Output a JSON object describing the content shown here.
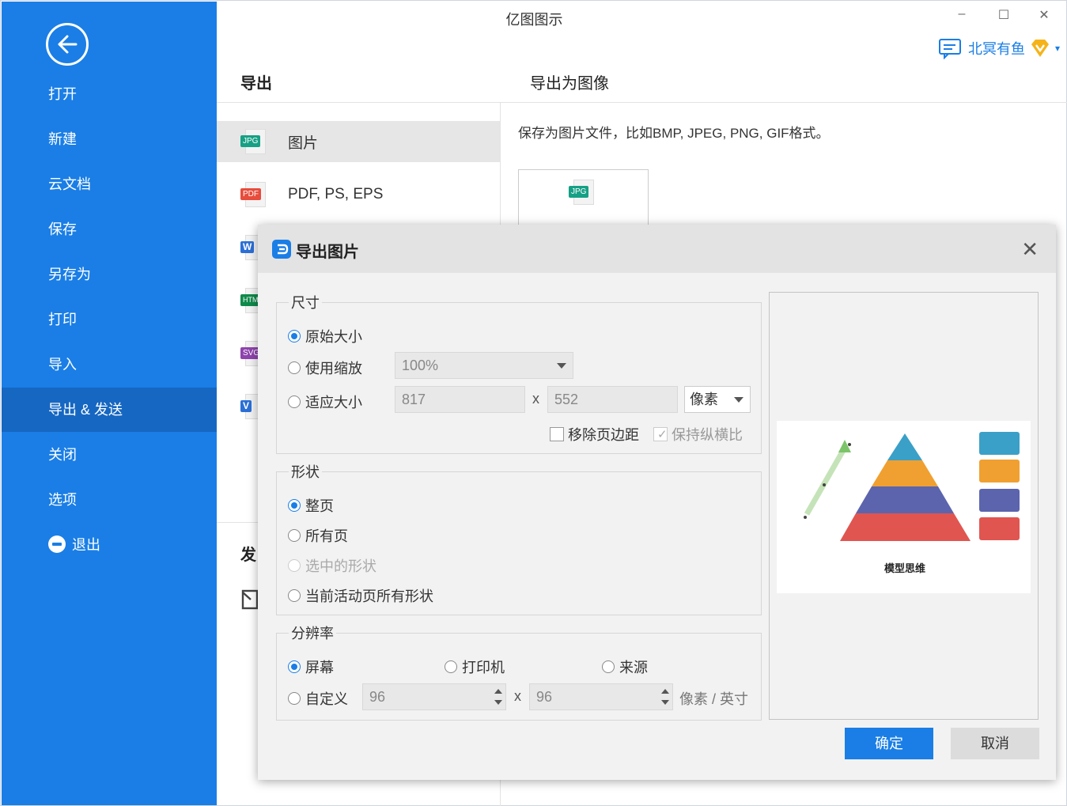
{
  "window": {
    "title": "亿图图示",
    "minimize_label": "–",
    "maximize_label": "☐",
    "close_label": "✕"
  },
  "user": {
    "name": "北冥有鱼",
    "badge": "V",
    "menu_caret": "▾"
  },
  "sidebar": {
    "items": [
      {
        "label": "打开"
      },
      {
        "label": "新建"
      },
      {
        "label": "云文档"
      },
      {
        "label": "保存"
      },
      {
        "label": "另存为"
      },
      {
        "label": "打印"
      },
      {
        "label": "导入"
      },
      {
        "label": "导出 & 发送"
      },
      {
        "label": "关闭"
      },
      {
        "label": "选项"
      },
      {
        "label": "退出"
      }
    ],
    "active_index": 7
  },
  "export_panel": {
    "heading": "导出",
    "formats": [
      {
        "label": "图片",
        "tag": "JPG",
        "tag_color": "#16a085"
      },
      {
        "label": "PDF, PS, EPS",
        "tag": "PDF",
        "tag_color": "#e74c3c"
      },
      {
        "label": "",
        "tag": "W",
        "tag_color": "#2b6fd6"
      },
      {
        "label": "",
        "tag": "HTML",
        "tag_color": "#0f8a4a"
      },
      {
        "label": "",
        "tag": "SVG",
        "tag_color": "#8e44ad"
      },
      {
        "label": "",
        "tag": "V",
        "tag_color": "#2b6fd6"
      }
    ],
    "send_heading": "发",
    "detail_heading": "导出为图像",
    "description": "保存为图片文件，比如BMP, JPEG, PNG, GIF格式。",
    "thumb_tag": "JPG"
  },
  "dialog": {
    "title": "导出图片",
    "close_label": "✕",
    "size_group": {
      "label": "尺寸",
      "original": "原始大小",
      "scale": "使用缩放",
      "scale_value": "100%",
      "fit": "适应大小",
      "width": "817",
      "height": "552",
      "x_sep": "x",
      "unit": "像素",
      "remove_margin": "移除页边距",
      "keep_ratio": "保持纵横比"
    },
    "shape_group": {
      "label": "形状",
      "whole_page": "整页",
      "all_pages": "所有页",
      "selected": "选中的形状",
      "active_page_shapes": "当前活动页所有形状"
    },
    "resolution_group": {
      "label": "分辨率",
      "screen": "屏幕",
      "printer": "打印机",
      "source": "来源",
      "custom": "自定义",
      "dpi_x": "96",
      "dpi_y": "96",
      "x_sep": "x",
      "unit": "像素 / 英寸"
    },
    "preview": {
      "diagram_title": "模型思维",
      "pyramid_colors": [
        "#3aa0c8",
        "#f0a030",
        "#5b64ad",
        "#e05550"
      ],
      "arrow_color": "#7cc46a",
      "card_colors": [
        "#3aa0c8",
        "#f0a030",
        "#5b64ad",
        "#e05550"
      ]
    },
    "ok_label": "确定",
    "cancel_label": "取消"
  }
}
